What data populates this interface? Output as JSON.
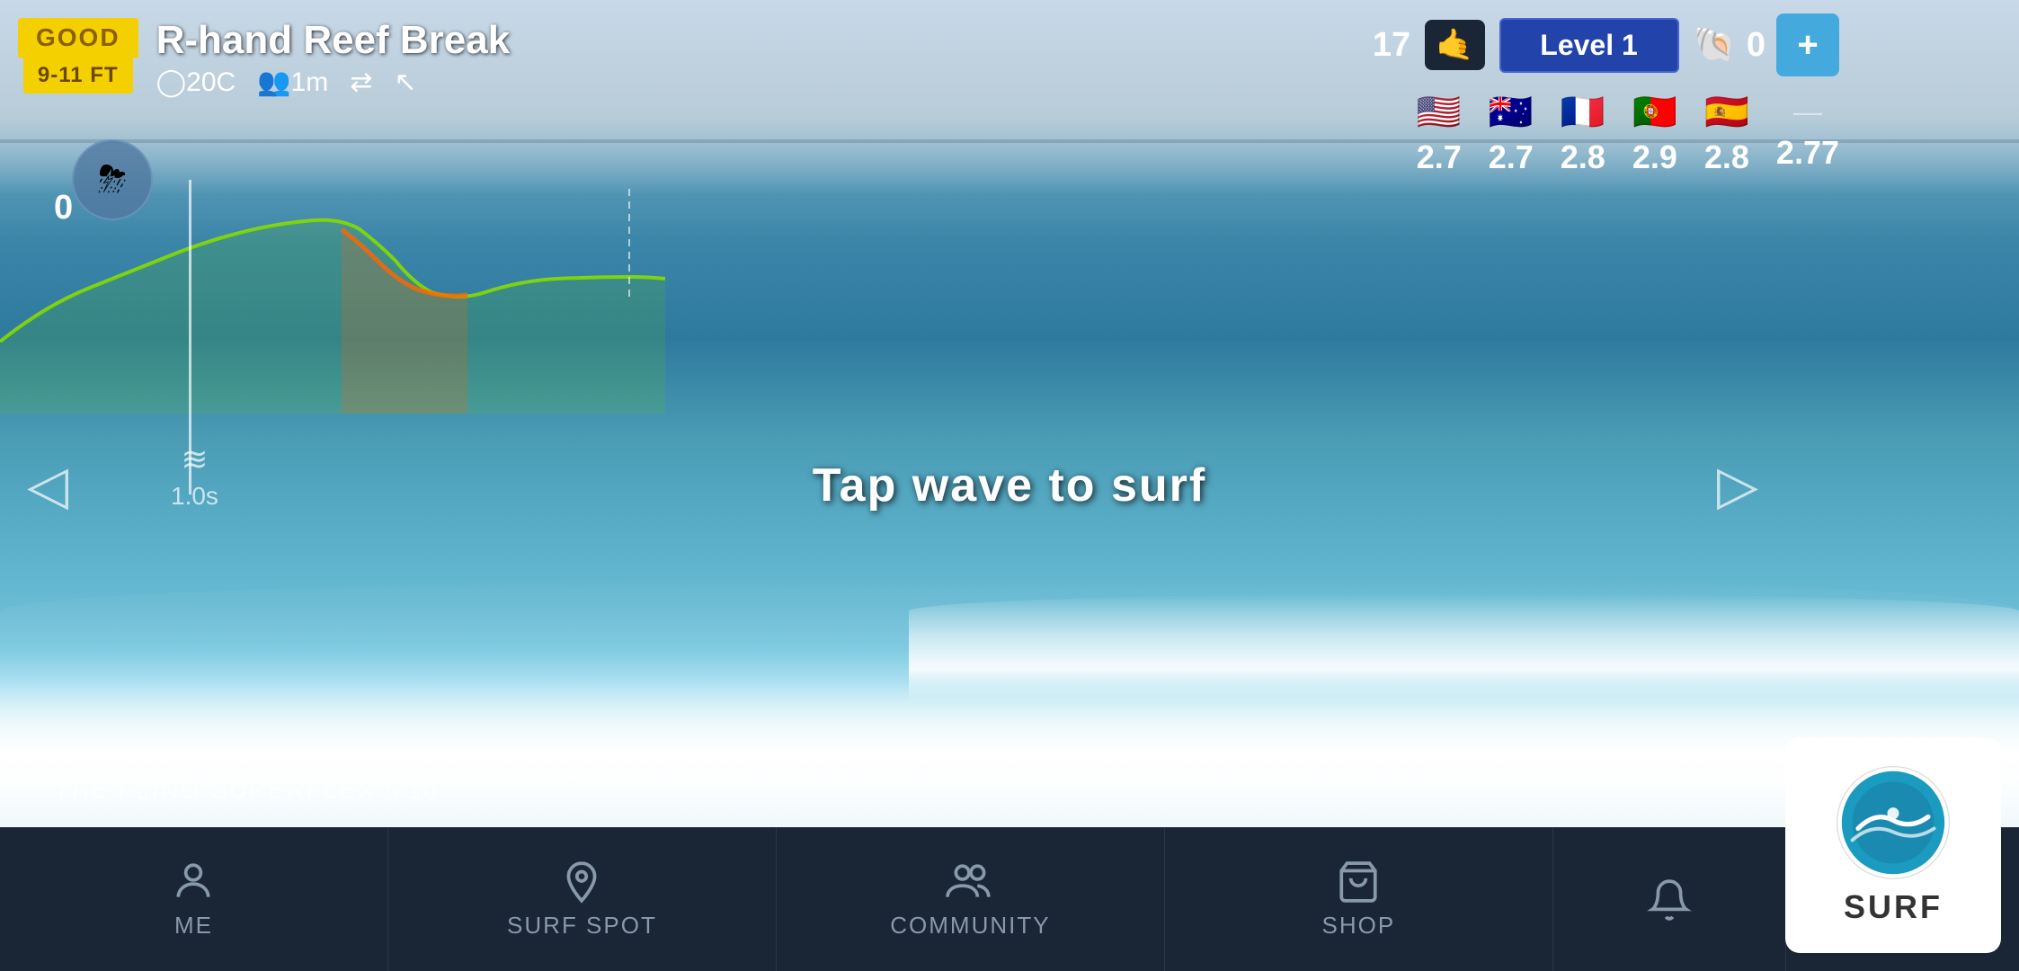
{
  "condition": {
    "quality_label": "GOOD",
    "size_label": "9-11 FT",
    "wave_name": "R-hand Reef Break",
    "temperature": "◯20C",
    "visibility": "👥1m",
    "wind_direction": "⇄",
    "cursor_icon": "↖"
  },
  "player": {
    "count": "17",
    "level_label": "Level 1",
    "coins": "0"
  },
  "judges": [
    {
      "flag": "🇺🇸",
      "score": "2.7"
    },
    {
      "flag": "🇦🇺",
      "score": "2.7"
    },
    {
      "flag": "🇫🇷",
      "score": "2.8"
    },
    {
      "flag": "🇵🇹",
      "score": "2.9"
    },
    {
      "flag": "🇪🇸",
      "score": "2.8"
    },
    {
      "flag": "",
      "score": "2.77"
    }
  ],
  "ui": {
    "tap_instruction": "Tap wave to surf",
    "board_name": "THE FLING SUPERFLEX 5'10\"",
    "score": "0",
    "wind_time": "1.0s",
    "add_button": "+",
    "surf_label": "SURF"
  },
  "nav": {
    "items": [
      {
        "label": "ME",
        "icon": "person"
      },
      {
        "label": "SURF SPOT",
        "icon": "location"
      },
      {
        "label": "COMMUNITY",
        "icon": "group"
      },
      {
        "label": "SHOP",
        "icon": "cart"
      }
    ],
    "bell_icon": "bell",
    "settings_icon": "gear"
  }
}
